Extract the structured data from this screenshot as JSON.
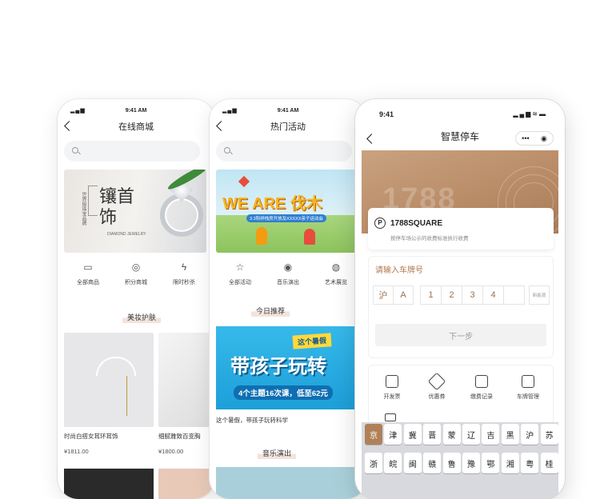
{
  "status_time": "9:41 AM",
  "status_time_p3": "9:41",
  "p1": {
    "title": "在线商城",
    "banner": {
      "main": "镶首饰",
      "cn_small": "世界级珠宝品牌",
      "en": "DIAMOND JEWELRY"
    },
    "cats": [
      {
        "icon": "store-icon",
        "label": "全部商品"
      },
      {
        "icon": "coin-icon",
        "label": "积分商城"
      },
      {
        "icon": "flash-icon",
        "label": "限时秒杀"
      }
    ],
    "section": "美妆护肤",
    "products": [
      {
        "name": "时尚白搭女耳环耳饰",
        "price": "¥1811.00"
      },
      {
        "name": "细腻雅致百变胸",
        "price": "¥1800.00"
      }
    ]
  },
  "p2": {
    "title": "热门活动",
    "banner": {
      "headline": "WE ARE 伐木",
      "sub": "3.3阳祥栈房开放及XXXXX亲子运动会"
    },
    "cats": [
      {
        "icon": "star-icon",
        "label": "全部活动"
      },
      {
        "icon": "music-icon",
        "label": "音乐演出"
      },
      {
        "icon": "planet-icon",
        "label": "艺术展览"
      }
    ],
    "section1": "今日推荐",
    "promo": {
      "tag": "这个暑假",
      "headline": "带孩子玩转",
      "sub": "4个主题16次课，低至62元"
    },
    "caption": "这个暑假，带孩子玩转科学",
    "section2": "音乐演出"
  },
  "p3": {
    "title": "智慧停车",
    "hero_number": "1788",
    "parking": {
      "name": "1788SQUARE",
      "sub": "按停车场公示的收费标准执行收费",
      "icon": "P"
    },
    "plate_label": "请输入车牌号",
    "plate_chars": [
      "沪",
      "A",
      "1",
      "2",
      "3",
      "4",
      ""
    ],
    "new_energy": "新能源",
    "next_btn": "下一步",
    "tools": [
      {
        "icon": "ticket-icon",
        "label": "开发票"
      },
      {
        "icon": "coupon-icon",
        "label": "优惠券"
      },
      {
        "icon": "record-icon",
        "label": "缴费记录"
      },
      {
        "icon": "car-manage-icon",
        "label": "车牌管理"
      }
    ],
    "keyboard_row1": [
      "京",
      "津",
      "冀",
      "晋",
      "蒙",
      "辽",
      "吉",
      "黑",
      "沪",
      "苏"
    ],
    "keyboard_row2": [
      "浙",
      "皖",
      "闽",
      "赣",
      "鲁",
      "豫",
      "鄂",
      "湘",
      "粤",
      "桂"
    ],
    "selected_key": "京"
  }
}
